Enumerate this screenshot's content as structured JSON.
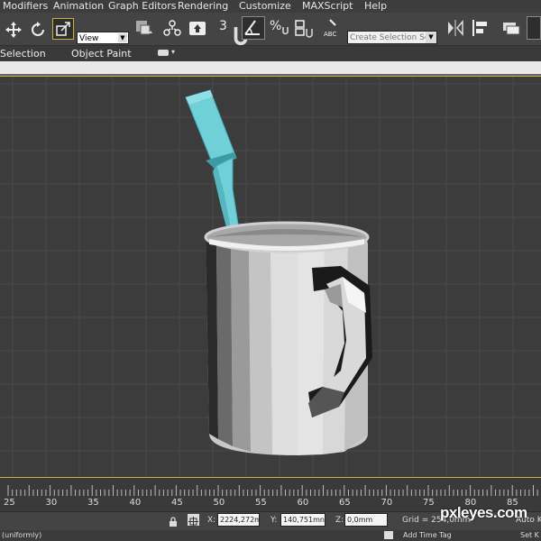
{
  "menu": {
    "items": [
      "Modifiers",
      "Animation",
      "Graph Editors",
      "Rendering",
      "Customize",
      "MAXScript",
      "Help"
    ]
  },
  "toolbar": {
    "reference_coord": "View",
    "selection_set_placeholder": "Create Selection Se",
    "snap_label": "3"
  },
  "ribbon": {
    "tabs": [
      "Selection",
      "Object Paint"
    ]
  },
  "timeline": {
    "ticks": [
      "25",
      "30",
      "35",
      "40",
      "45",
      "50",
      "55",
      "60",
      "65",
      "70",
      "75",
      "80",
      "85"
    ]
  },
  "status": {
    "x_label": "X:",
    "x_value": "2224,272m",
    "y_label": "Y:",
    "y_value": "140,751mn",
    "z_label": "Z:",
    "z_value": "0,0mm",
    "grid": "Grid = 254,0mm",
    "auto_key": "Auto K"
  },
  "bottom": {
    "left": "(uniformly)",
    "add_time_tag": "Add Time Tag",
    "set_key": "Set K"
  },
  "watermark": "pxleyes.com",
  "colors": {
    "viewport_bg": "#3c3c3c",
    "grid_line": "#4a4a4a",
    "viewport_border": "#c7b23a",
    "toothbrush": "#6fd0d8",
    "mug": "#d0d0d0"
  }
}
